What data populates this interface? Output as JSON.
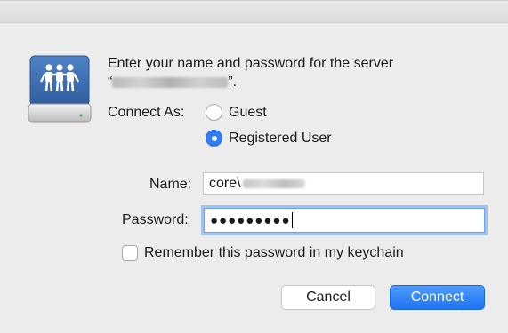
{
  "dialog": {
    "prompt_line1": "Enter your name and password for the server",
    "prompt_quote_open": "“",
    "prompt_quote_close": "”."
  },
  "connect_as": {
    "label": "Connect As:",
    "options": [
      {
        "label": "Guest",
        "selected": false
      },
      {
        "label": "Registered User",
        "selected": true
      }
    ]
  },
  "name_field": {
    "label": "Name:",
    "value": "core\\"
  },
  "password_field": {
    "label": "Password:",
    "masked_value": "●●●●●●●●●"
  },
  "remember": {
    "label": "Remember this password in my keychain",
    "checked": false
  },
  "buttons": {
    "cancel": "Cancel",
    "connect": "Connect"
  },
  "colors": {
    "accent": "#2f7df6",
    "background": "#ececec",
    "icon": "#3d6fb5"
  },
  "icons": {
    "server": "shared-server-drive-icon"
  }
}
